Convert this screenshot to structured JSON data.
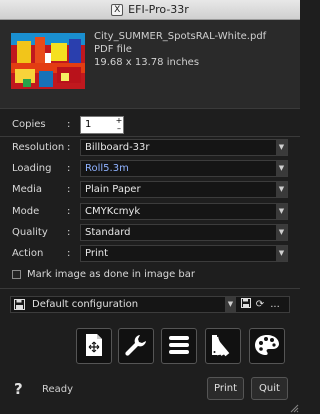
{
  "window": {
    "title": "EFI-Pro-33r"
  },
  "file": {
    "name": "City_SUMMER_SpotsRAL-White.pdf",
    "type": "PDF file",
    "size": "19.68 x 13.78 inches"
  },
  "fields": {
    "copies": {
      "label": "Copies",
      "value": "1"
    },
    "resolution": {
      "label": "Resolution",
      "value": "Billboard-33r"
    },
    "loading": {
      "label": "Loading",
      "value": "Roll5.3m"
    },
    "media": {
      "label": "Media",
      "value": "Plain Paper"
    },
    "mode": {
      "label": "Mode",
      "value": "CMYKcmyk"
    },
    "quality": {
      "label": "Quality",
      "value": "Standard"
    },
    "action": {
      "label": "Action",
      "value": "Print"
    }
  },
  "colon": ":",
  "mark_done": {
    "label": "Mark image as done in image bar",
    "checked": false
  },
  "configuration": {
    "value": "Default configuration",
    "more": "..."
  },
  "toolbar": {
    "icons": [
      "page-crop-icon",
      "wrench-icon",
      "list-icon",
      "swatches-icon",
      "palette-icon"
    ]
  },
  "footer": {
    "help": "?",
    "status": "Ready",
    "print": "Print",
    "quit": "Quit"
  },
  "colors": {
    "accent_value": "#8fb2ff",
    "background": "#1e1e1e"
  }
}
